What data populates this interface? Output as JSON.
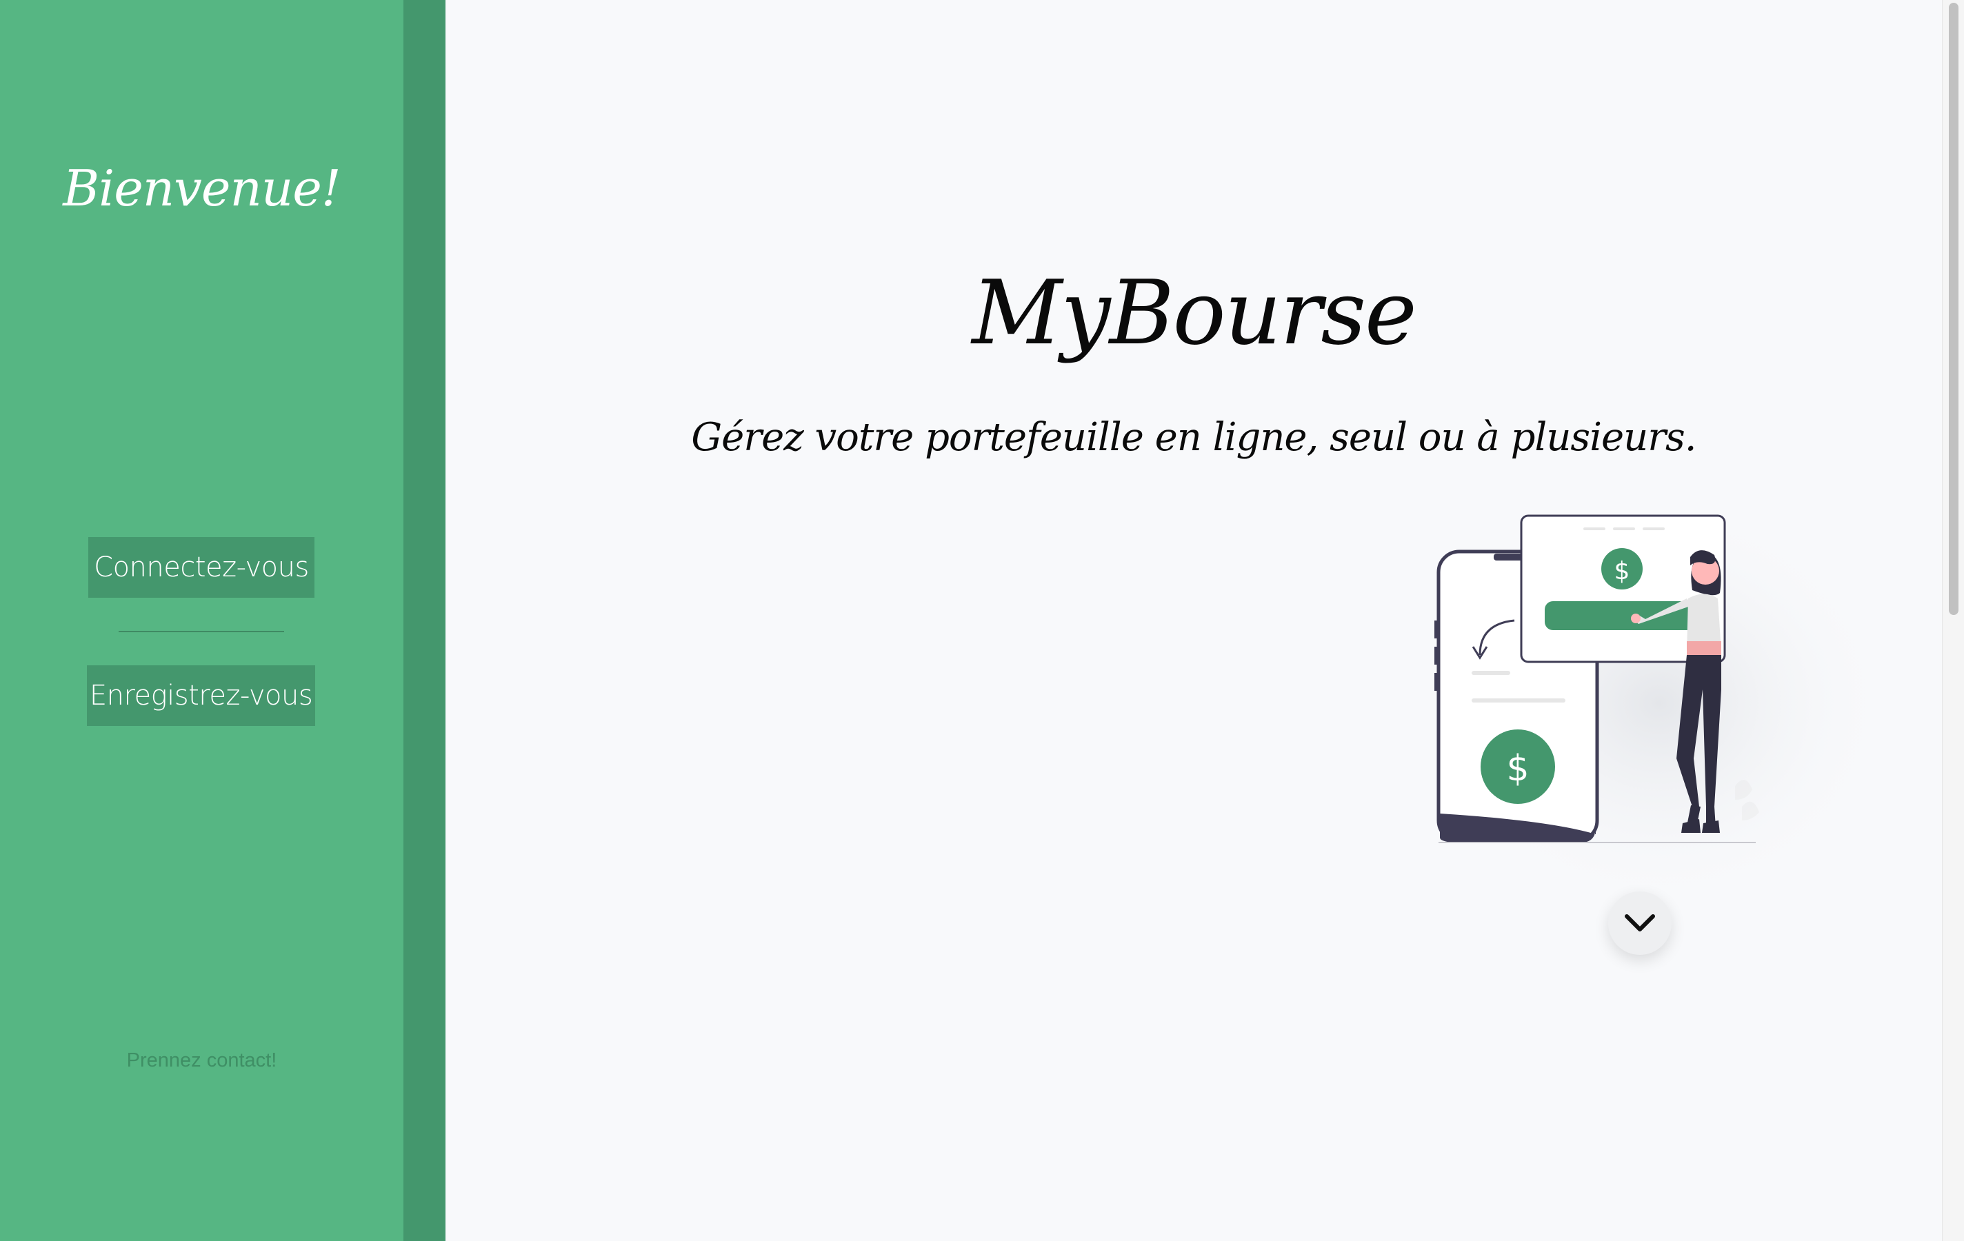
{
  "sidebar": {
    "welcome": "Bienvenue!",
    "login_button": "Connectez-vous",
    "register_button": "Enregistrez-vous",
    "contact_link": "Prennez contact!"
  },
  "main": {
    "title": "MyBourse",
    "tagline": "Gérez votre portefeuille en ligne, seul ou à plusieurs.",
    "illustration_icon": "mobile-payment-illustration",
    "scroll_down_icon": "chevron-down-icon"
  },
  "colors": {
    "sidebar_bg": "#56b683",
    "sidebar_edge": "#44976d",
    "button_bg": "#44976d",
    "main_bg": "#f8f9fb",
    "accent_green": "#44976d"
  }
}
